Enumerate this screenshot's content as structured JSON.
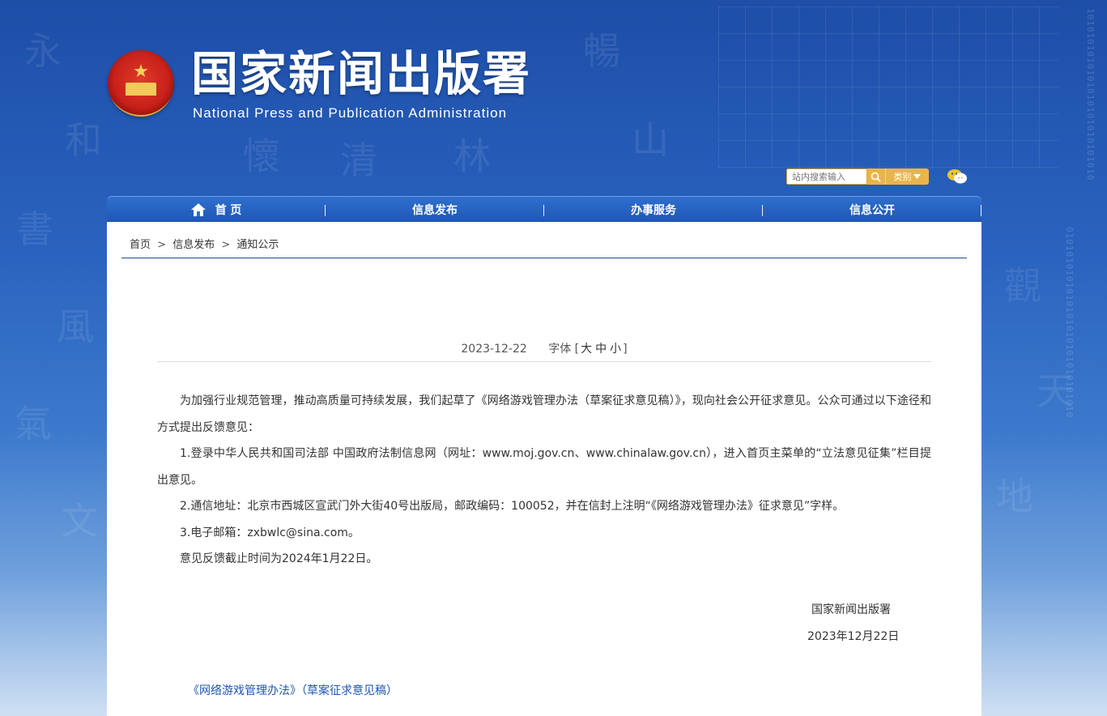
{
  "header": {
    "title": "国家新闻出版署",
    "subtitle": "National  Press and Publication Administration"
  },
  "search": {
    "placeholder": "站内搜索输入",
    "category_label": "类别",
    "search_icon": "search-icon",
    "category_icon": "caret-down-icon",
    "wechat_icon": "wechat-icon"
  },
  "nav": {
    "items": [
      {
        "label": "首 页",
        "icon": "home-icon"
      },
      {
        "label": "信息发布"
      },
      {
        "label": "办事服务"
      },
      {
        "label": "信息公开"
      }
    ]
  },
  "breadcrumb": {
    "items": [
      "首页",
      "信息发布",
      "通知公示"
    ],
    "separator": ">"
  },
  "article": {
    "date": "2023-12-22",
    "font_label": "字体",
    "font_open": "[",
    "font_sizes": [
      "大",
      "中",
      "小"
    ],
    "font_close": "]",
    "paragraphs": [
      "为加强行业规范管理，推动高质量可持续发展，我们起草了《网络游戏管理办法（草案征求意见稿）》，现向社会公开征求意见。公众可通过以下途径和方式提出反馈意见：",
      "1.登录中华人民共和国司法部 中国政府法制信息网（网址：www.moj.gov.cn、www.chinalaw.gov.cn），进入首页主菜单的“立法意见征集”栏目提出意见。",
      "2.通信地址：北京市西城区宣武门外大街40号出版局，邮政编码：100052，并在信封上注明“《网络游戏管理办法》征求意见”字样。",
      "3.电子邮箱：zxbwlc@sina.com。",
      "意见反馈截止时间为2024年1月22日。"
    ],
    "signature_org": "国家新闻出版署",
    "signature_date": "2023年12月22日",
    "attachment": "《网络游戏管理办法》（草案征求意见稿）"
  },
  "colors": {
    "nav_bg": "#1f56b3",
    "accent_gold": "#e9b54a",
    "link": "#1f56b3",
    "divider": "#1f4e8c"
  }
}
